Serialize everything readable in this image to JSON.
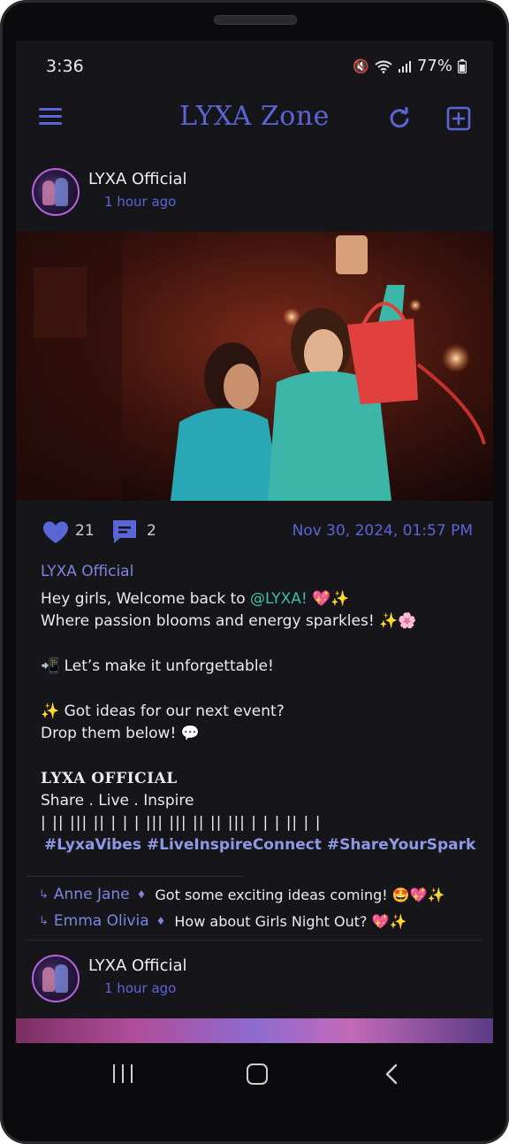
{
  "status_bar": {
    "time": "3:36",
    "battery": "77%"
  },
  "app_bar": {
    "title": "LYXA Zone",
    "icons": {
      "menu": "menu-icon",
      "refresh": "refresh-icon",
      "add": "add-post-icon"
    }
  },
  "post": {
    "author": "LYXA Official",
    "time_ago": "1 hour ago",
    "likes": "21",
    "comments_count": "2",
    "date": "Nov 30, 2024, 01:57 PM",
    "caption": {
      "author": "LYXA Official",
      "line1_prefix": "Hey girls, Welcome back to ",
      "mention": "@LYXA!",
      "line1_suffix": " 💖✨",
      "line2": "Where passion blooms and energy sparkles! ✨🌸",
      "line3": "📲 Let’s make it unforgettable!",
      "line4": "✨ Got ideas for our next event?",
      "line5": "Drop them below! 💬",
      "brand": "LYXA OFFICIAL",
      "tagline": "Share . Live . Inspire",
      "bars": "| || ||| || | | | ||| ||| || || ||| | | | || | |",
      "hashtags": "#LyxaVibes #LiveInspireConnect #ShareYourSpark"
    },
    "replies": [
      {
        "name": "Anne Jane",
        "text": "Got some exciting ideas coming! 🤩💖✨"
      },
      {
        "name": "Emma Olivia",
        "text": "How about Girls Night Out? 💖✨"
      }
    ]
  },
  "post2": {
    "author": "LYXA Official",
    "time_ago": "1 hour ago"
  },
  "colors": {
    "accent": "#5a66d6",
    "mention": "#3ec2a7",
    "background": "#15151a"
  }
}
